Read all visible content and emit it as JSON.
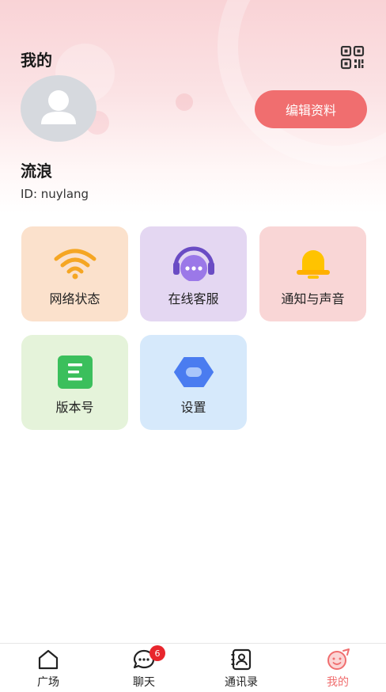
{
  "header": {
    "title": "我的",
    "qr_icon": "qr-code-icon",
    "edit_button": "编辑资料"
  },
  "profile": {
    "avatar_icon": "user-avatar-icon",
    "nickname": "流浪",
    "user_id": "ID: nuylang"
  },
  "menu": [
    {
      "label": "网络状态",
      "icon": "wifi-icon",
      "color": "#f5a623"
    },
    {
      "label": "在线客服",
      "icon": "headset-icon",
      "color": "#8d62d9"
    },
    {
      "label": "通知与声音",
      "icon": "bell-icon",
      "color": "#ffc300"
    },
    {
      "label": "版本号",
      "icon": "document-icon",
      "color": "#3bbf5c"
    },
    {
      "label": "设置",
      "icon": "settings-icon",
      "color": "#4a7cf0"
    }
  ],
  "tabbar": {
    "items": [
      {
        "label": "广场",
        "icon": "home-icon",
        "active": false
      },
      {
        "label": "聊天",
        "icon": "chat-icon",
        "active": false,
        "badge": "6"
      },
      {
        "label": "通讯录",
        "icon": "contacts-icon",
        "active": false
      },
      {
        "label": "我的",
        "icon": "profile-face-icon",
        "active": true
      }
    ],
    "accent_color": "#f06e6f"
  }
}
